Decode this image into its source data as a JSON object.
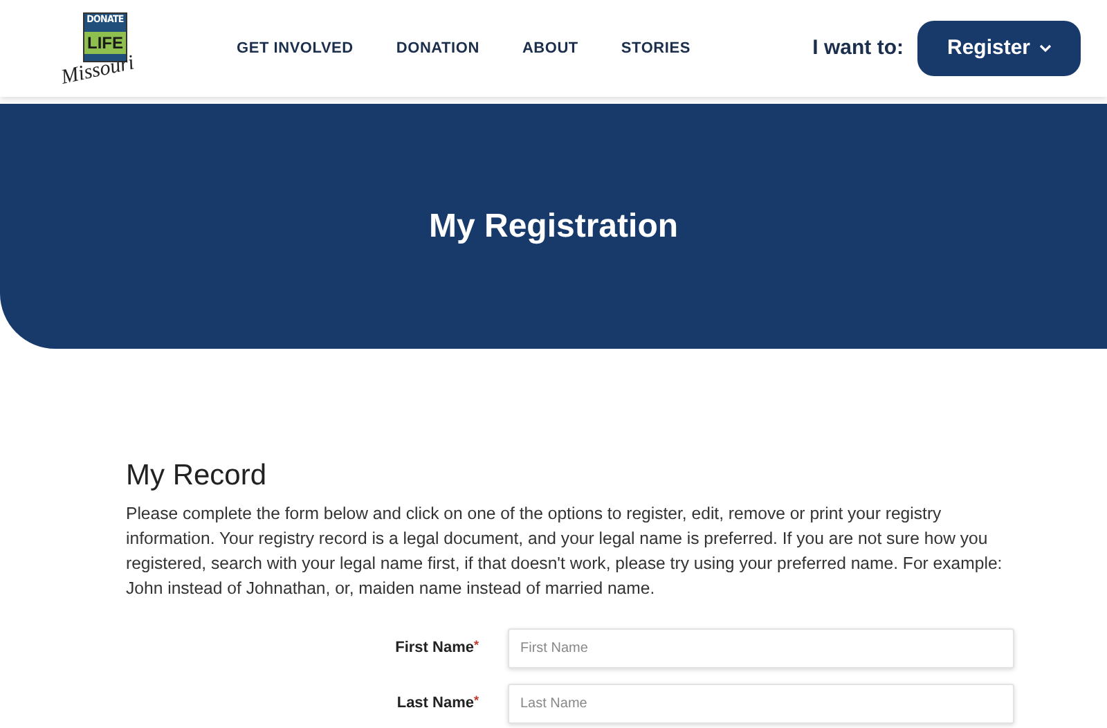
{
  "logo": {
    "top": "DONATE",
    "middle": "LIFE",
    "script": "Missouri"
  },
  "nav": [
    {
      "label": "GET INVOLVED"
    },
    {
      "label": "DONATION"
    },
    {
      "label": "ABOUT"
    },
    {
      "label": "STORIES"
    }
  ],
  "cta": {
    "prompt": "I want to:",
    "button": "Register"
  },
  "banner": {
    "title": "My Registration"
  },
  "section": {
    "heading": "My Record",
    "text": "Please complete the form below and click on one of the options to register, edit, remove or print your registry information. Your registry record is a legal document, and your legal name is preferred. If you are not sure how you registered, search with your legal name first, if that doesn't work, please try using your preferred name. For example: John instead of Johnathan, or, maiden name instead of married name."
  },
  "fields": [
    {
      "label": "First Name",
      "required_mark": "*",
      "placeholder": "First Name"
    },
    {
      "label": "Last Name",
      "required_mark": "*",
      "placeholder": "Last Name"
    }
  ]
}
